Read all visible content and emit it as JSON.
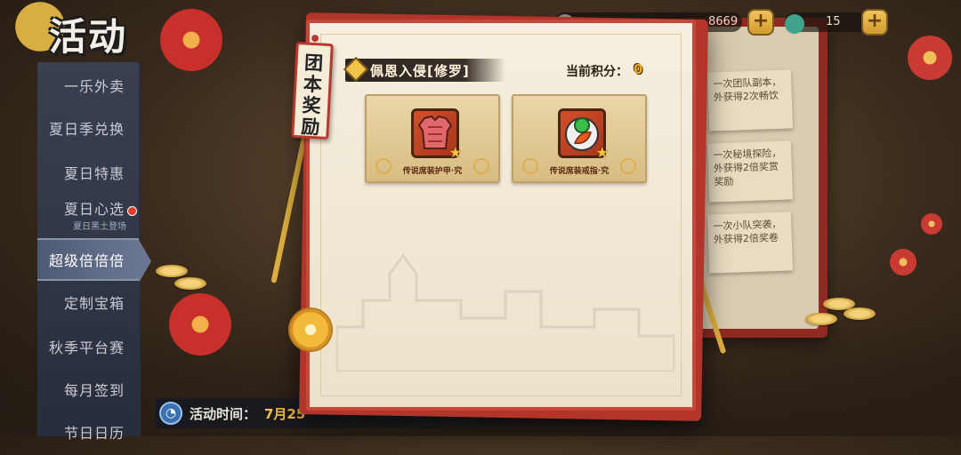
{
  "side": {
    "title": "活动",
    "items": [
      {
        "label": "一乐外卖"
      },
      {
        "label": "夏日季兑换"
      },
      {
        "label": "夏日特惠"
      },
      {
        "label": "夏日心选",
        "sub": "夏日黑土登场"
      },
      {
        "label": "超级倍倍倍"
      },
      {
        "label": "定制宝箱"
      },
      {
        "label": "秋季平台赛"
      },
      {
        "label": "每月签到"
      },
      {
        "label": "节日日历"
      }
    ]
  },
  "top": {
    "currency1": "8669",
    "currency2": "15"
  },
  "panel": {
    "tag": "团本奖励",
    "stage": "佩恩入侵[修罗]",
    "score_label": "当前积分：",
    "score_value": "0",
    "rewards": [
      {
        "name": "传说席装护甲·究",
        "icon": "armor-icon"
      },
      {
        "name": "传说席装戒指·究",
        "icon": "ring-orb-icon"
      }
    ]
  },
  "notes": [
    "一次团队副本，外获得2次畅饮",
    "一次秘境探险，外获得2倍奖赏奖励",
    "一次小队突袭，外获得2倍奖卷"
  ],
  "bottom": {
    "time_label": "活动时间：",
    "time_value": "7月25"
  }
}
